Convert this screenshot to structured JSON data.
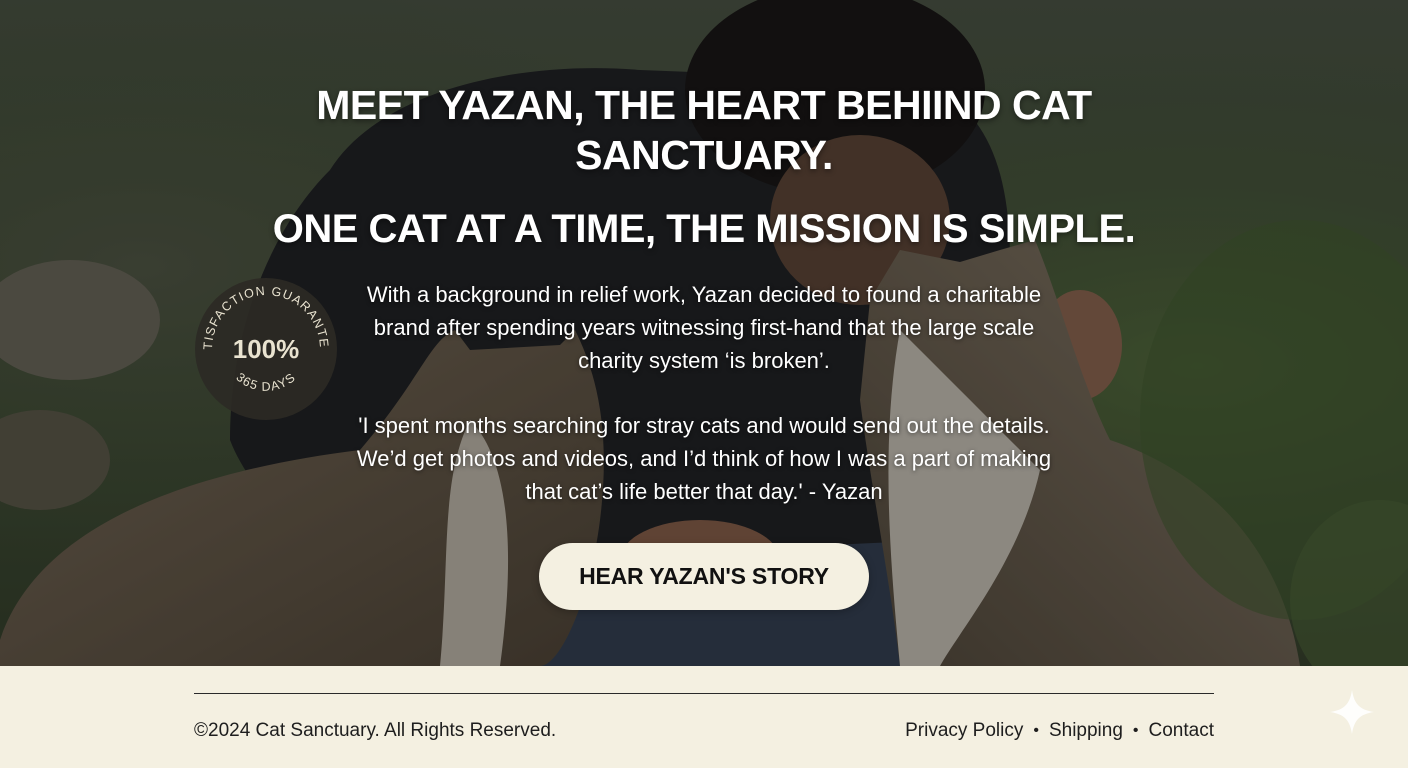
{
  "hero": {
    "headline": "MEET YAZAN, THE HEART BEHIIND CAT SANCTUARY.",
    "subheadline": "ONE CAT AT A TIME, THE MISSION IS SIMPLE.",
    "paragraph_1": "With a background in relief work, Yazan decided to found a charitable brand after spending years witnessing first-hand that the large scale charity system ‘is broken’.",
    "paragraph_2": "'I spent months searching for stray cats and would send out the details. We’d get photos and videos, and I’d think of how I was a part of making that cat’s life better that day.' - Yazan",
    "cta_label": "HEAR YAZAN'S STORY"
  },
  "badge": {
    "top_text": "SATISFACTION GUARANTEED",
    "center_text": "100%",
    "bottom_text": "365 DAYS"
  },
  "footer": {
    "copyright": "©2024 Cat Sanctuary. All Rights Reserved.",
    "links": [
      "Privacy Policy",
      "Shipping",
      "Contact"
    ],
    "separator": "•"
  },
  "icons": {
    "badge": "badge-seal-icon",
    "sparkle": "sparkle-icon"
  },
  "colors": {
    "cream": "#f4f0e1",
    "text_dark": "#1e1e1e",
    "badge_bg": "#2c2a25"
  }
}
